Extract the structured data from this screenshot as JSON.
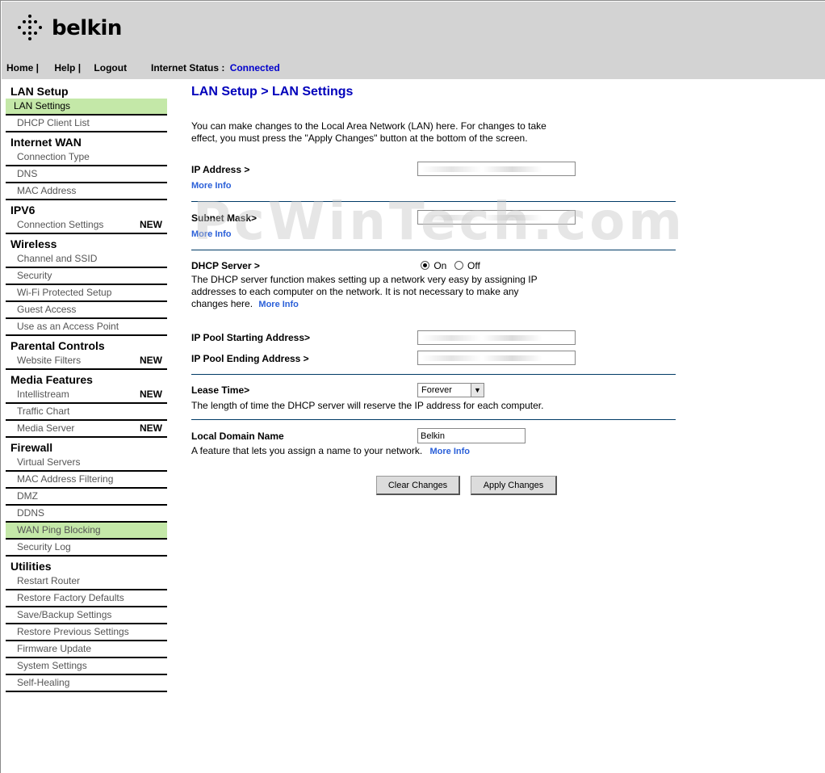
{
  "brand": {
    "name": "belkin"
  },
  "topnav": {
    "home": "Home |",
    "help": "Help |",
    "logout": "Logout"
  },
  "status": {
    "label": "Internet Status :",
    "value": "Connected"
  },
  "sidebar": {
    "sections": [
      {
        "title": "LAN Setup",
        "items": [
          {
            "label": "LAN Settings"
          },
          {
            "label": "DHCP Client List"
          }
        ]
      },
      {
        "title": "Internet WAN",
        "items": [
          {
            "label": "Connection Type"
          },
          {
            "label": "DNS"
          },
          {
            "label": "MAC Address"
          }
        ]
      },
      {
        "title": "IPV6",
        "items": [
          {
            "label": "Connection Settings",
            "badge": "NEW"
          }
        ]
      },
      {
        "title": "Wireless",
        "items": [
          {
            "label": "Channel and SSID"
          },
          {
            "label": "Security"
          },
          {
            "label": "Wi-Fi Protected Setup"
          },
          {
            "label": "Guest Access"
          },
          {
            "label": "Use as an Access Point"
          }
        ]
      },
      {
        "title": "Parental Controls",
        "items": [
          {
            "label": "Website Filters",
            "badge": "NEW"
          }
        ]
      },
      {
        "title": "Media Features",
        "items": [
          {
            "label": "Intellistream",
            "badge": "NEW"
          },
          {
            "label": "Traffic Chart"
          },
          {
            "label": "Media Server",
            "badge": "NEW"
          }
        ]
      },
      {
        "title": "Firewall",
        "items": [
          {
            "label": "Virtual Servers"
          },
          {
            "label": "MAC Address Filtering"
          },
          {
            "label": "DMZ"
          },
          {
            "label": "DDNS"
          },
          {
            "label": "WAN Ping Blocking"
          },
          {
            "label": "Security Log"
          }
        ]
      },
      {
        "title": "Utilities",
        "items": [
          {
            "label": "Restart Router"
          },
          {
            "label": "Restore Factory Defaults"
          },
          {
            "label": "Save/Backup Settings"
          },
          {
            "label": "Restore Previous Settings"
          },
          {
            "label": "Firmware Update"
          },
          {
            "label": "System Settings"
          },
          {
            "label": "Self-Healing"
          }
        ]
      }
    ]
  },
  "main": {
    "title": "LAN Setup > LAN Settings",
    "intro": "You can make changes to the Local Area Network (LAN) here. For changes to take effect, you must press the \"Apply Changes\" button at the bottom of the screen.",
    "ip_address_label": "IP Address >",
    "subnet_mask_label": "Subnet Mask>",
    "more_info": "More Info",
    "dhcp_label": "DHCP Server >",
    "dhcp_on": "On",
    "dhcp_off": "Off",
    "dhcp_desc": "The DHCP server function makes setting up a network very easy by assigning IP addresses to each computer on the network. It is not necessary to make any changes here.",
    "pool_start_label": "IP Pool Starting Address>",
    "pool_end_label": "IP Pool Ending Address >",
    "lease_label": "Lease Time>",
    "lease_value": "Forever",
    "lease_desc": "The length of time the DHCP server will reserve the IP address for each computer.",
    "domain_label": "Local Domain Name",
    "domain_value": "Belkin",
    "domain_desc": "A feature that lets you assign a name to your network.",
    "clear_button": "Clear Changes",
    "apply_button": "Apply Changes"
  },
  "watermark": "PcWinTech.com",
  "colors": {
    "header_bg": "#d3d3d3",
    "active_item": "#c4e8a8",
    "title": "#0000bb",
    "link": "#2a5fd8"
  }
}
